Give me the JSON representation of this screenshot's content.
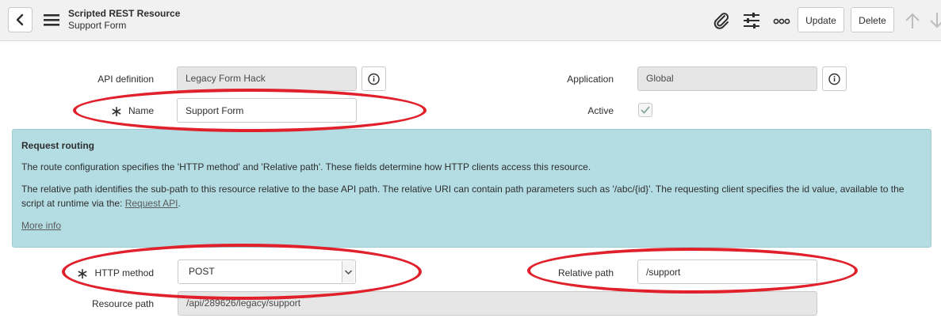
{
  "header": {
    "title": "Scripted REST Resource",
    "subtitle": "Support Form",
    "update_label": "Update",
    "delete_label": "Delete",
    "icons": [
      "back-icon",
      "menu-icon",
      "paperclip-icon",
      "sliders-icon",
      "more-icon",
      "arrow-up-icon",
      "arrow-down-icon"
    ]
  },
  "form": {
    "api_definition": {
      "label": "API definition",
      "value": "Legacy Form Hack"
    },
    "name": {
      "label": "Name",
      "value": "Support Form",
      "required": true
    },
    "application": {
      "label": "Application",
      "value": "Global"
    },
    "active": {
      "label": "Active",
      "checked": true
    },
    "http_method": {
      "label": "HTTP method",
      "value": "POST",
      "required": true
    },
    "relative_path": {
      "label": "Relative path",
      "value": "/support"
    },
    "resource_path": {
      "label": "Resource path",
      "value": "/api/289626/legacy/support"
    }
  },
  "request_routing": {
    "heading": "Request routing",
    "p1": "The route configuration specifies the 'HTTP method' and 'Relative path'. These fields determine how HTTP clients access this resource.",
    "p2_line1": "The relative path identifies the sub-path to this resource relative to the base API path. The relative URI can contain path parameters such as '/abc/{id}'. The requesting client specifies the id value, available to the",
    "p2_line2_prefix": "script at runtime via the: ",
    "p2_link": "Request API",
    "p2_suffix": ".",
    "more_info": "More info"
  },
  "colors": {
    "annotation": "#e0202a",
    "info_background": "#b3dde3",
    "readonly_field": "#e6e6e6",
    "header_background": "#f1f1f1",
    "checkmark": "#8aa6a0"
  }
}
